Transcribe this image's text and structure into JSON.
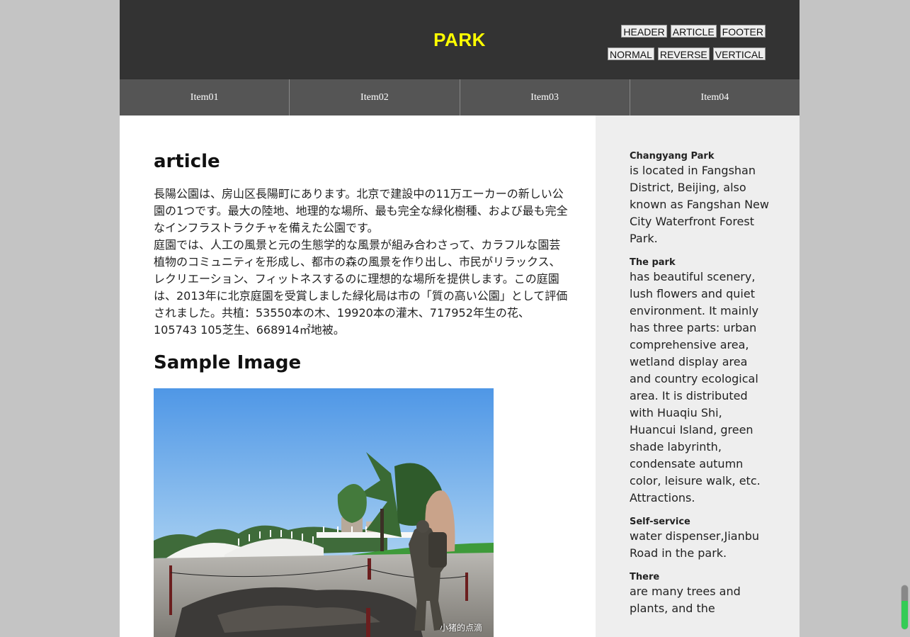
{
  "header": {
    "title": "PARK",
    "buttons_row1": [
      "HEADER",
      "ARTICLE",
      "FOOTER"
    ],
    "buttons_row2": [
      "NORMAL",
      "REVERSE",
      "VERTICAL"
    ]
  },
  "nav": {
    "items": [
      "Item01",
      "Item02",
      "Item03",
      "Item04"
    ]
  },
  "article": {
    "heading": "article",
    "body": "長陽公園は、房山区長陽町にあります。北京で建設中の11万エーカーの新しい公園の1つです。最大の陸地、地理的な場所、最も完全な緑化樹種、および最も完全なインフラストラクチャを備えた公園です。\n庭園では、人工の風景と元の生態学的な風景が組み合わさって、カラフルな園芸植物のコミュニティを形成し、都市の森の風景を作り出し、市民がリラックス、レクリエーション、フィットネスするのに理想的な場所を提供します。この庭園は、2013年に北京庭園を受賞しました緑化局は市の「質の高い公園」として評価されました。共植：53550本の木、19920本の灌木、717952年生の花、105743 105芝生、668914㎡地被。",
    "sample_heading": "Sample Image",
    "image_watermark": "小猪的点滴"
  },
  "aside": {
    "blocks": [
      {
        "title": "Changyang Park",
        "text": "is located in Fangshan District, Beijing, also known as Fangshan New City Waterfront Forest Park."
      },
      {
        "title": "The park",
        "text": "has beautiful scenery, lush flowers and quiet environment. It mainly has three parts: urban comprehensive area, wetland display area and country ecological area. It is distributed with Huaqiu Shi, Huancui Island, green shade labyrinth, condensate autumn color, leisure walk, etc. Attractions."
      },
      {
        "title": "Self-service",
        "text": "water dispenser,Jianbu Road in the park."
      },
      {
        "title": "There",
        "text": "are many trees and plants, and the"
      }
    ]
  },
  "colors": {
    "header_bg": "#333333",
    "title_color": "#ffff00",
    "nav_bg": "#555555",
    "aside_bg": "#eeeeee",
    "page_bg": "#c4c4c4"
  }
}
